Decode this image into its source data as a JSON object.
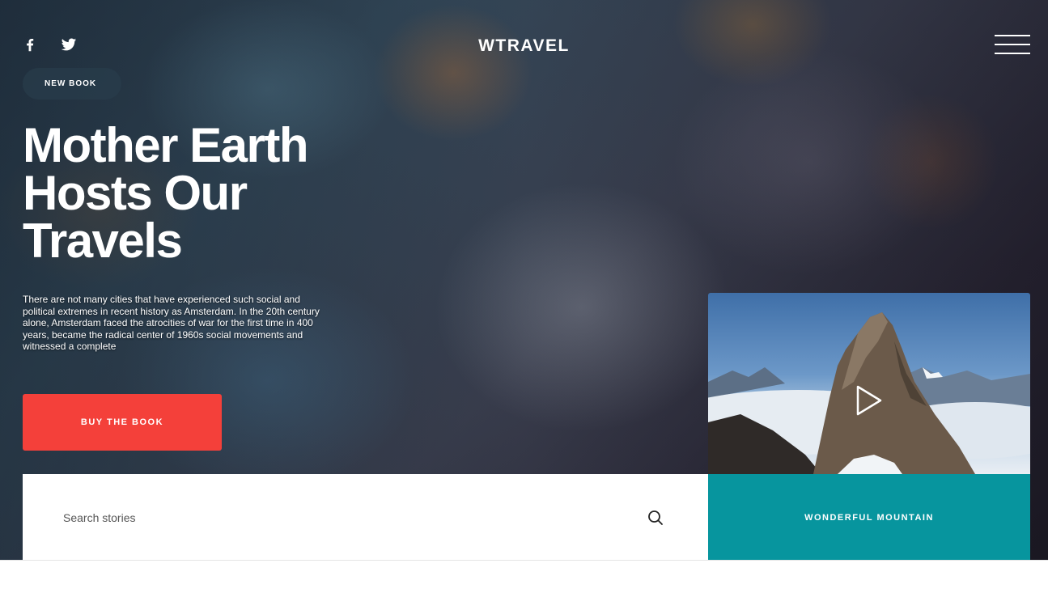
{
  "header": {
    "brand": "WTRAVEL",
    "social": [
      "facebook-icon",
      "twitter-icon"
    ],
    "menu_icon": "hamburger-menu-icon"
  },
  "hero": {
    "badge": "NEW BOOK",
    "title": "Mother Earth Hosts Our Travels",
    "description": "There are not many cities that have experienced such social and political extremes in recent history as Amsterdam. In the 20th century alone, Amsterdam faced the atrocities of war for the first time in 400 years, became the radical center of 1960s social movements and witnessed a complete",
    "cta": "BUY THE BOOK"
  },
  "search": {
    "placeholder": "Search stories",
    "value": "",
    "icon": "search-icon"
  },
  "video": {
    "caption": "WONDERFUL MOUNTAIN",
    "icon": "play-icon"
  },
  "colors": {
    "accent": "#f4403a",
    "teal": "#07959e",
    "text_light": "#ffffff"
  }
}
